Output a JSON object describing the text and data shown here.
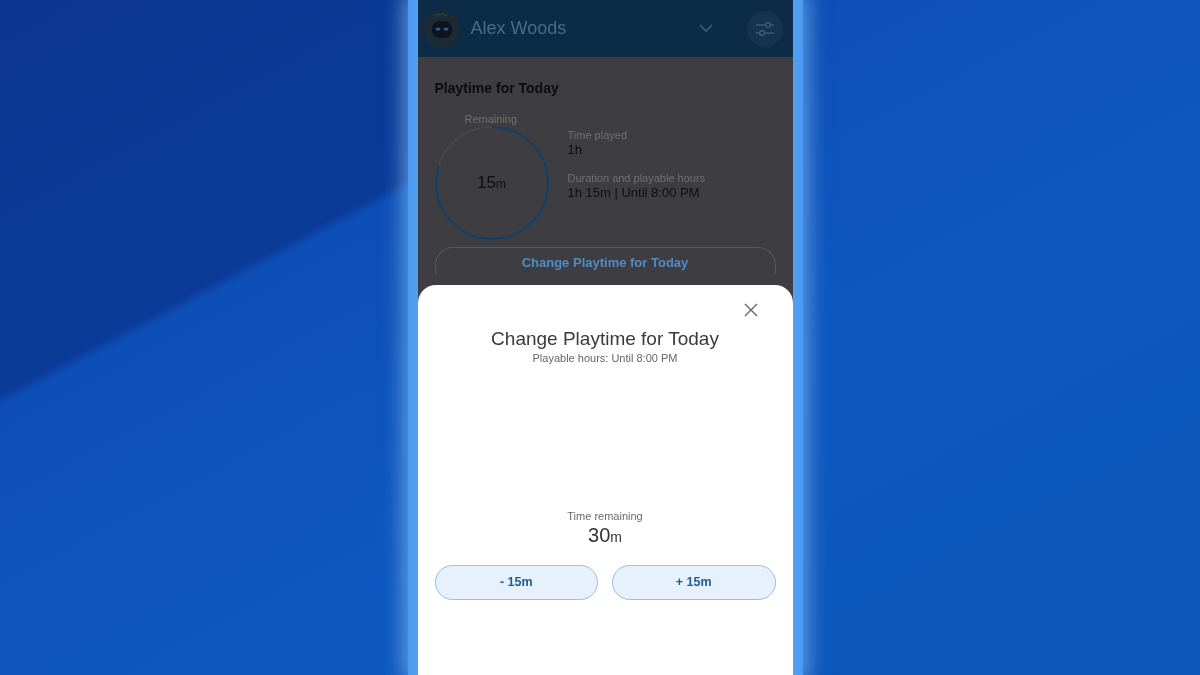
{
  "screen": {
    "dimmed": true
  },
  "header": {
    "user_name": "Alex Woods"
  },
  "playtime_card": {
    "title": "Playtime for Today",
    "ring": {
      "label": "Remaining",
      "value": "15",
      "unit": "m",
      "level": 0.8
    },
    "stats": [
      {
        "label": "Time played",
        "value": "1h"
      },
      {
        "label": "Duration and playable hours",
        "value": "1h 15m | Until 8:00 PM"
      }
    ],
    "button": "Change Playtime for Today"
  },
  "sheet": {
    "title": "Change Playtime for Today",
    "subtitle": "Playable hours: Until 8:00 PM",
    "remaining_label": "Time remaining",
    "remaining_value": "30",
    "remaining_unit": "m",
    "buttons": [
      "- 15m",
      "+ 15m"
    ]
  }
}
